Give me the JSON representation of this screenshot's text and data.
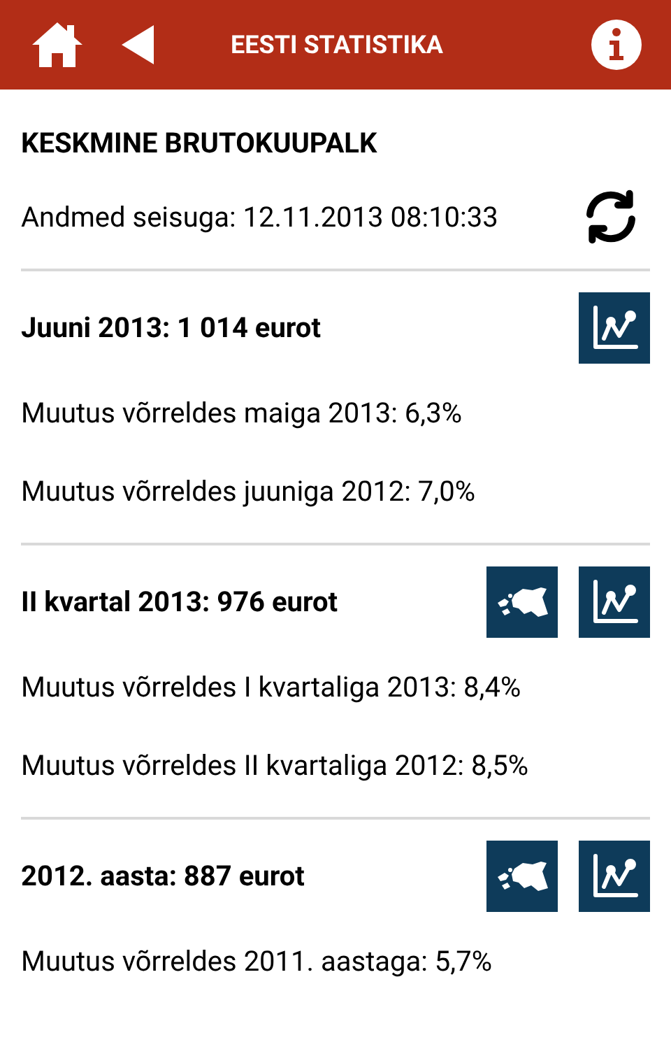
{
  "header": {
    "title": "EESTI STATISTIKA"
  },
  "page": {
    "title": "KESKMINE BRUTOKUUPALK",
    "updated": "Andmed seisuga: 12.11.2013 08:10:33"
  },
  "sections": [
    {
      "title": "Juuni 2013: 1 014 eurot",
      "buttons": [
        {
          "kind": "chart"
        }
      ],
      "lines": [
        "Muutus võrreldes maiga 2013: 6,3%",
        "Muutus võrreldes juuniga 2012: 7,0%"
      ]
    },
    {
      "title": "II kvartal 2013: 976 eurot",
      "buttons": [
        {
          "kind": "map"
        },
        {
          "kind": "chart"
        }
      ],
      "lines": [
        "Muutus võrreldes I kvartaliga 2013: 8,4%",
        "Muutus võrreldes II kvartaliga 2012: 8,5%"
      ]
    },
    {
      "title": "2012. aasta: 887 eurot",
      "buttons": [
        {
          "kind": "map"
        },
        {
          "kind": "chart"
        }
      ],
      "lines": [
        "Muutus võrreldes 2011. aastaga: 5,7%"
      ]
    }
  ]
}
